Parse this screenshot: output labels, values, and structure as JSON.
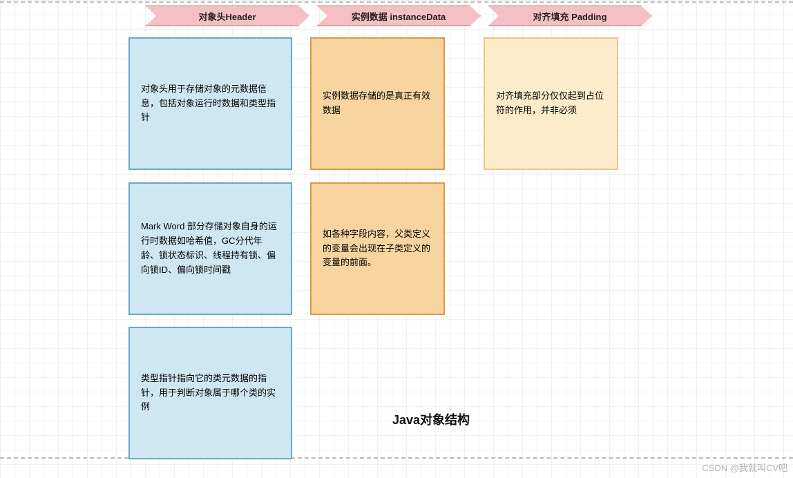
{
  "headers": {
    "col1": "对象头Header",
    "col2": "实例数据 instanceData",
    "col3": "对齐填充 Padding"
  },
  "boxes": {
    "blue1": "对象头用于存储对象的元数据信息，包括对象运行时数据和类型指针",
    "blue2": "Mark Word 部分存储对象自身的运行时数据如哈希值，GC分代年龄、锁状态标识、线程持有锁、偏向锁ID、偏向锁时间戳",
    "blue3": "类型指针指向它的类元数据的指针，用于判断对象属于哪个类的实例",
    "orange1": "实例数据存储的是真正有效数据",
    "orange2": "如各种字段内容，父类定义的变量会出现在子类定义的变量的前面。",
    "yellow1": "对齐填充部分仅仅起到占位符的作用，并非必须"
  },
  "title": "Java对象结构",
  "watermark": "CSDN @我就叫CV吧"
}
